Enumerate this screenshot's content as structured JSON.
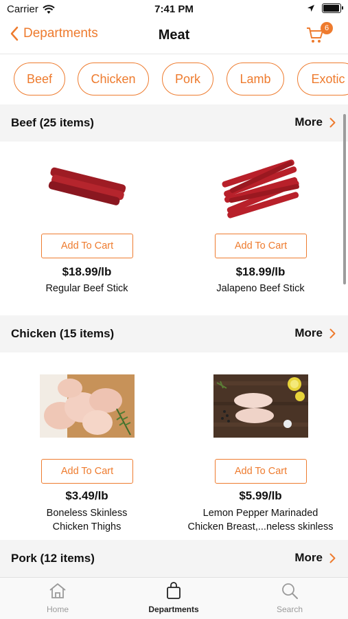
{
  "status": {
    "carrier": "Carrier",
    "time": "7:41 PM"
  },
  "nav": {
    "back_label": "Departments",
    "title": "Meat",
    "cart_count": "6"
  },
  "chips": [
    "Beef",
    "Chicken",
    "Pork",
    "Lamb",
    "Exotic"
  ],
  "sections": [
    {
      "title": "Beef (25 items)",
      "more": "More",
      "products": [
        {
          "add": "Add To Cart",
          "price": "$18.99/lb",
          "name": "Regular Beef Stick"
        },
        {
          "add": "Add To Cart",
          "price": "$18.99/lb",
          "name": "Jalapeno Beef Stick"
        }
      ]
    },
    {
      "title": "Chicken (15 items)",
      "more": "More",
      "products": [
        {
          "add": "Add To Cart",
          "price": "$3.49/lb",
          "name_line1": "Boneless Skinless",
          "name_line2": "Chicken Thighs"
        },
        {
          "add": "Add To Cart",
          "price": "$5.99/lb",
          "name_line1": "Lemon Pepper Marinaded",
          "name_line2": "Chicken Breast,...neless skinless"
        }
      ]
    },
    {
      "title": "Pork (12 items)",
      "more": "More"
    }
  ],
  "tabs": [
    {
      "label": "Home"
    },
    {
      "label": "Departments"
    },
    {
      "label": "Search"
    }
  ],
  "colors": {
    "accent": "#ee7b2e",
    "section_bg": "#f4f4f4"
  }
}
